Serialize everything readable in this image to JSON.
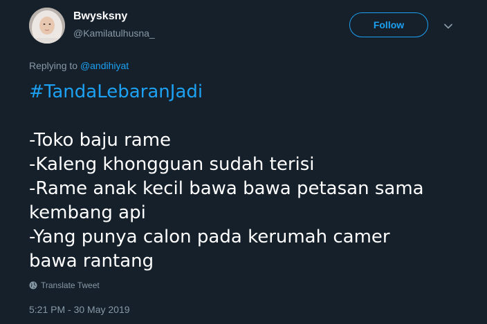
{
  "user": {
    "display_name": "Bwysksny",
    "handle": "@Kamilatulhusna_",
    "avatar_icon": "profile-photo"
  },
  "actions": {
    "follow_label": "Follow",
    "more_icon": "chevron-down-icon"
  },
  "reply": {
    "prefix": "Replying to",
    "mention": "@andihiyat"
  },
  "tweet": {
    "hashtag": "#TandaLebaranJadi",
    "lines": [
      "-Toko baju rame",
      "-Kaleng khongguan sudah terisi",
      "-Rame anak kecil bawa bawa petasan sama",
      "kembang api",
      "-Yang punya calon pada kerumah camer",
      "bawa rantang"
    ]
  },
  "translate_label": "Translate Tweet",
  "timestamp": "5:21 PM - 30 May 2019",
  "colors": {
    "background": "#15202b",
    "accent": "#1da1f2",
    "secondary_text": "#8899a6",
    "primary_text": "#ffffff"
  }
}
